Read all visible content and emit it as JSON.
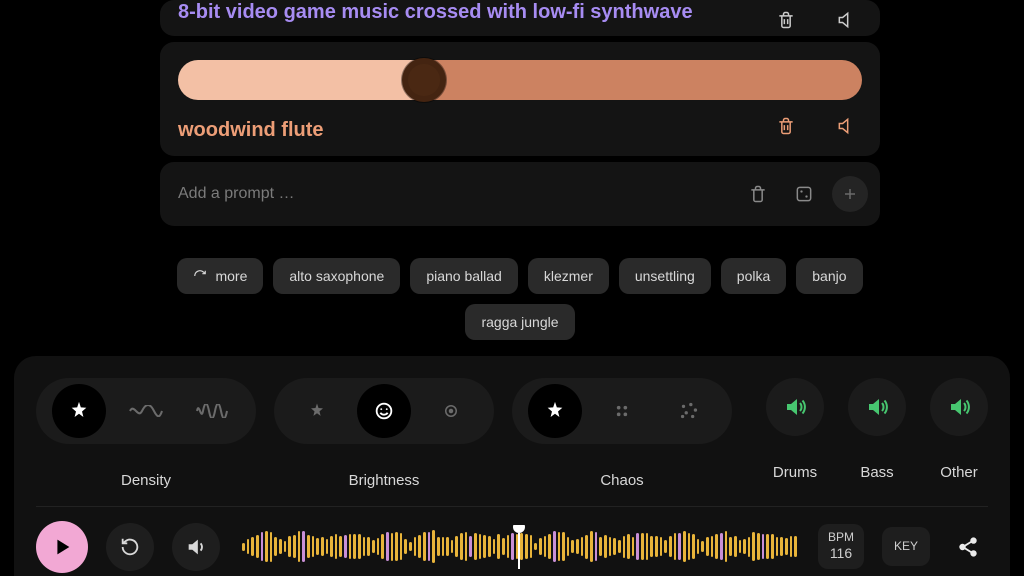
{
  "prompts": [
    {
      "text": "8-bit video game music crossed with low-fi synthwave",
      "color": "purple"
    },
    {
      "text": "woodwind flute",
      "color": "orange",
      "slider": 0.36
    }
  ],
  "addPrompt": {
    "placeholder": "Add a prompt …"
  },
  "chips": {
    "more": "more",
    "items": [
      "alto saxophone",
      "piano ballad",
      "klezmer",
      "unsettling",
      "polka",
      "banjo",
      "ragga jungle"
    ]
  },
  "controls": {
    "density": {
      "label": "Density",
      "selected": 0
    },
    "brightness": {
      "label": "Brightness",
      "selected": 1
    },
    "chaos": {
      "label": "Chaos",
      "selected": 0
    },
    "mutes": [
      {
        "label": "Drums"
      },
      {
        "label": "Bass"
      },
      {
        "label": "Other"
      }
    ]
  },
  "transport": {
    "bpm": {
      "label": "BPM",
      "value": "116"
    },
    "key": {
      "label": "KEY"
    }
  }
}
